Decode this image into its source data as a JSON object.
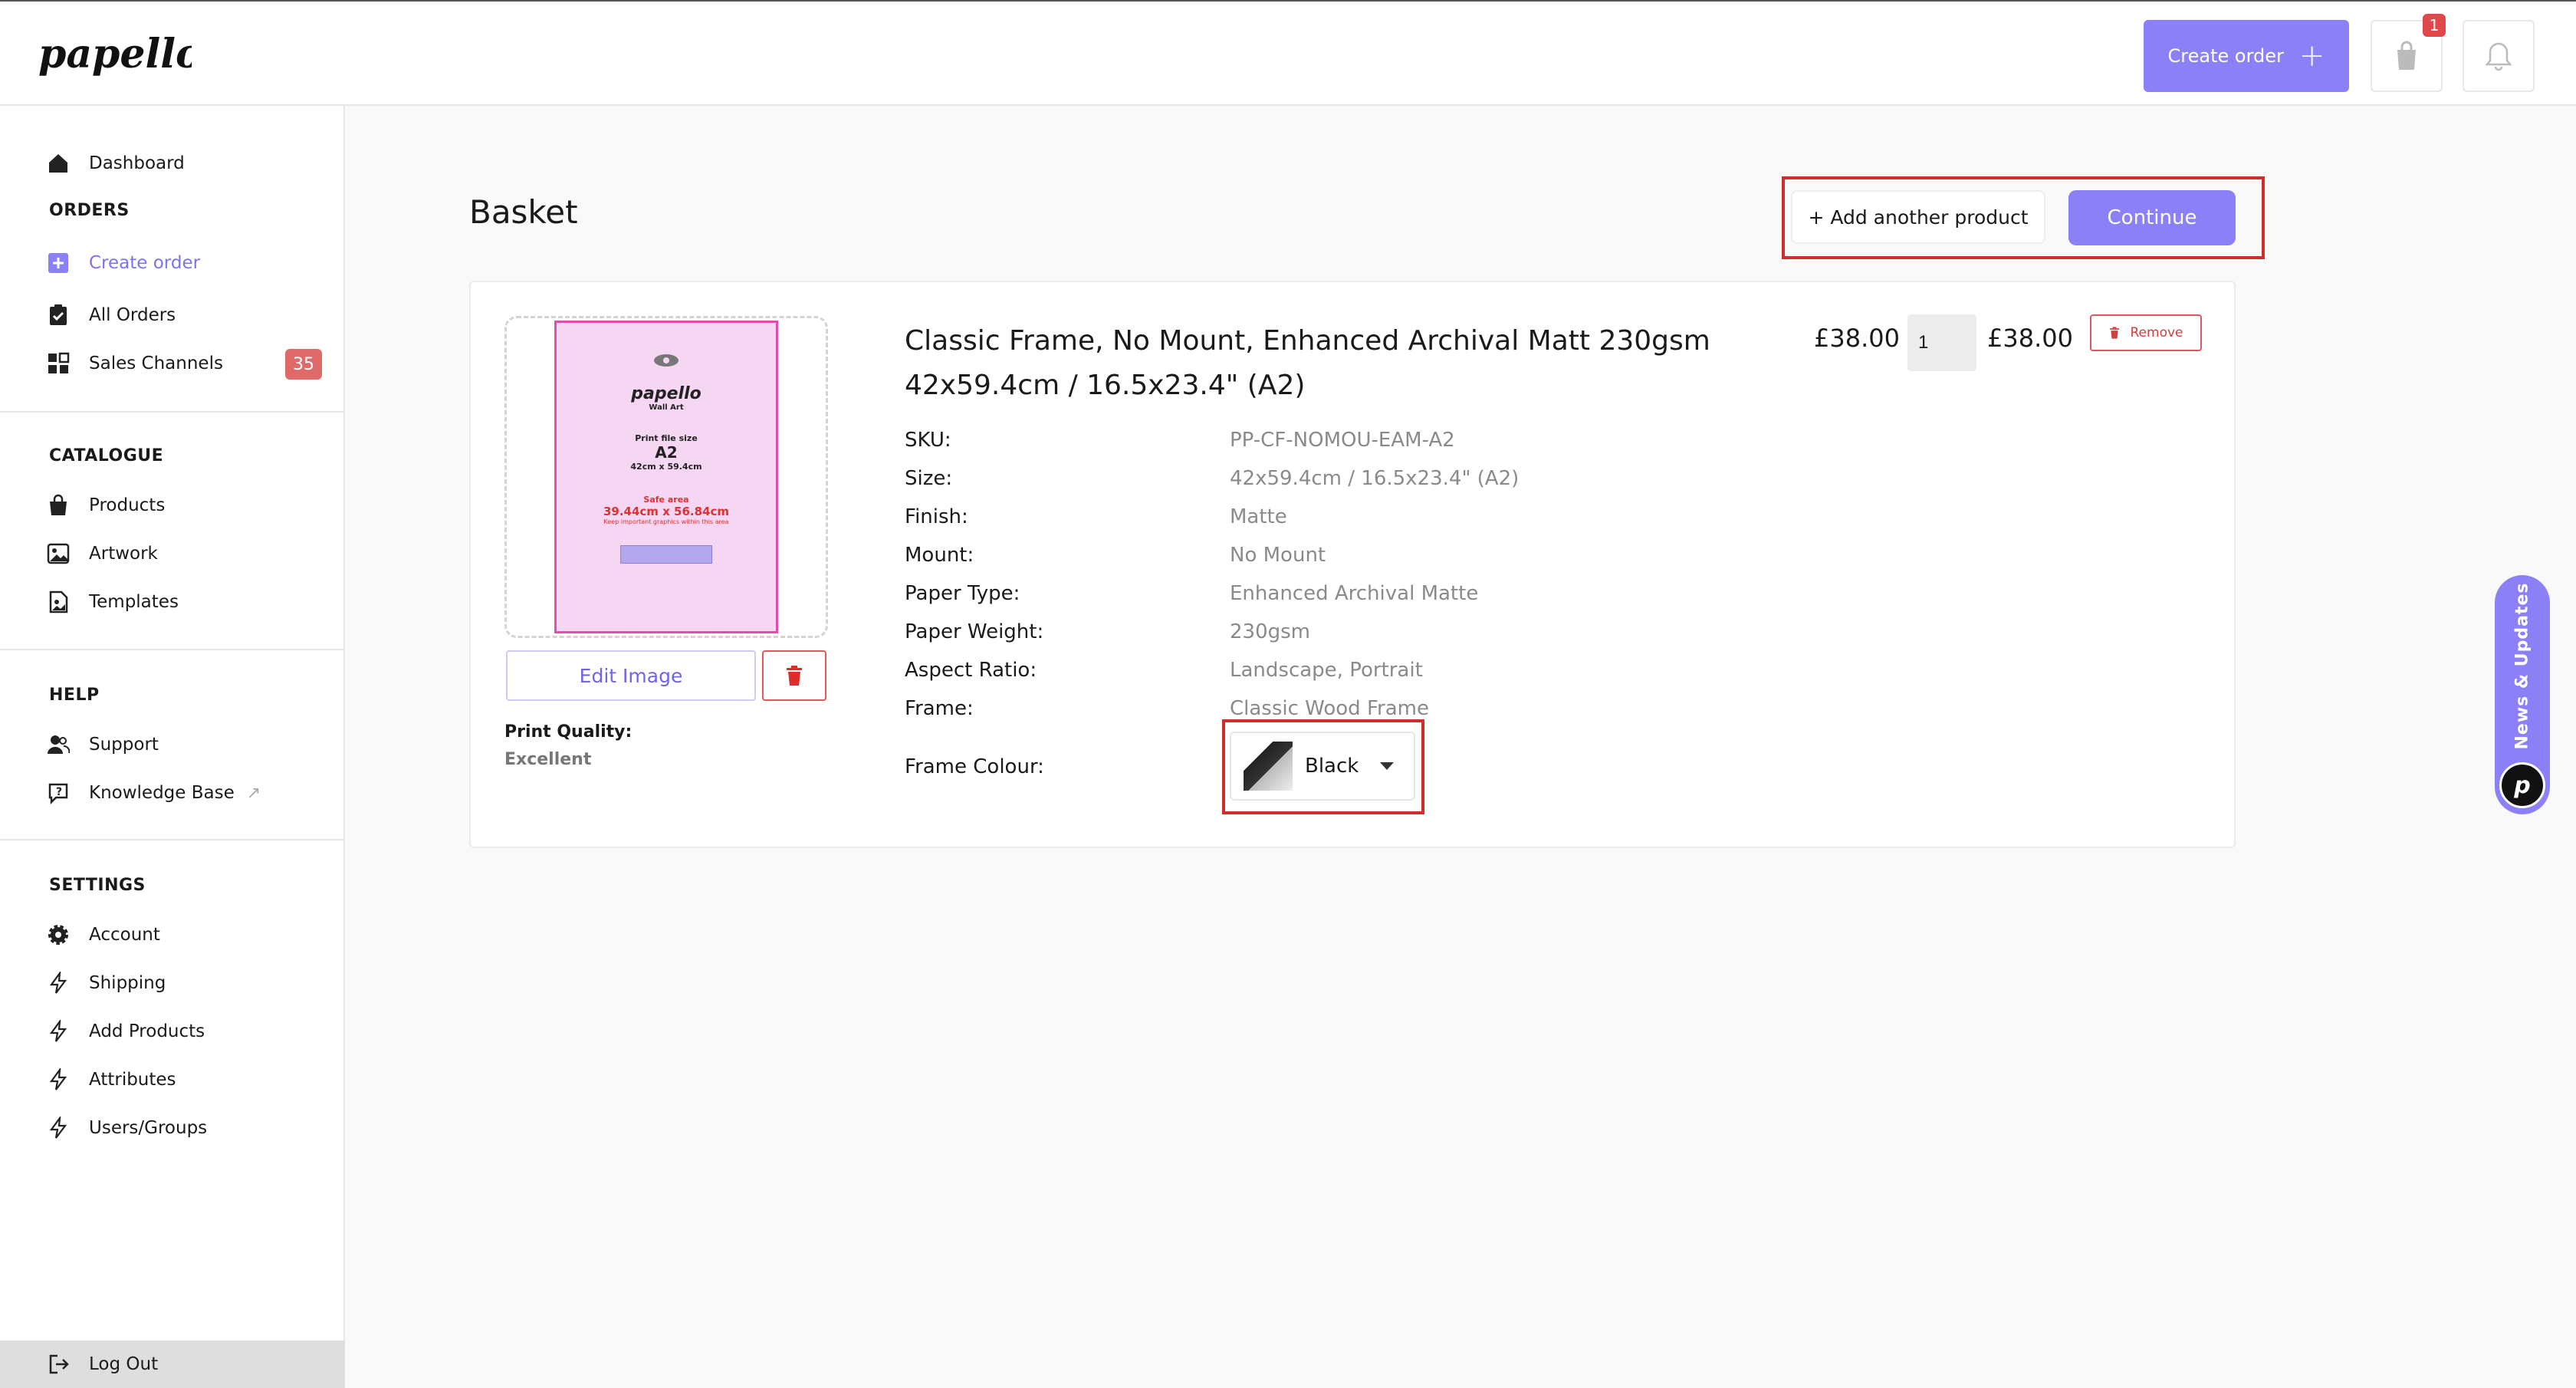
{
  "brand": {
    "logo_text": "papello"
  },
  "header": {
    "create_order_label": "Create order",
    "basket_count": "1"
  },
  "sidebar": {
    "items": [
      {
        "label": "Dashboard"
      },
      {
        "label": "Create order"
      },
      {
        "label": "All Orders"
      },
      {
        "label": "Sales Channels",
        "badge": "35"
      },
      {
        "label": "Products"
      },
      {
        "label": "Artwork"
      },
      {
        "label": "Templates"
      },
      {
        "label": "Support"
      },
      {
        "label": "Knowledge Base"
      },
      {
        "label": "Account"
      },
      {
        "label": "Shipping"
      },
      {
        "label": "Add Products"
      },
      {
        "label": "Attributes"
      },
      {
        "label": "Users/Groups"
      },
      {
        "label": "Log Out"
      }
    ],
    "sections": {
      "orders": "ORDERS",
      "catalogue": "CATALOGUE",
      "help": "HELP",
      "settings": "SETTINGS"
    }
  },
  "page": {
    "title": "Basket",
    "add_product_label": "+ Add another product",
    "continue_label": "Continue"
  },
  "product": {
    "title": "Classic Frame, No Mount, Enhanced Archival Matt 230gsm 42x59.4cm / 16.5x23.4\" (A2)",
    "unit_price": "£38.00",
    "quantity": "1",
    "total_price": "£38.00",
    "remove_label": "Remove",
    "edit_image_label": "Edit Image",
    "print_quality_label": "Print Quality:",
    "print_quality_value": "Excellent",
    "specs": [
      {
        "key": "SKU:",
        "value": "PP-CF-NOMOU-EAM-A2"
      },
      {
        "key": "Size:",
        "value": "42x59.4cm / 16.5x23.4\" (A2)"
      },
      {
        "key": "Finish:",
        "value": "Matte"
      },
      {
        "key": "Mount:",
        "value": "No Mount"
      },
      {
        "key": "Paper Type:",
        "value": "Enhanced Archival Matte"
      },
      {
        "key": "Paper Weight:",
        "value": "230gsm"
      },
      {
        "key": "Aspect Ratio:",
        "value": "Landscape, Portrait"
      },
      {
        "key": "Frame:",
        "value": "Classic Wood Frame"
      }
    ],
    "frame_colour_label": "Frame Colour:",
    "frame_colour_value": "Black",
    "preview": {
      "logo": "papello",
      "sub": "Wall Art",
      "print_file_size": "Print file size",
      "size_name": "A2",
      "size_dims": "42cm x 59.4cm",
      "safe_area": "Safe area",
      "safe_dims": "39.44cm x 56.84cm",
      "safe_note": "Keep important graphics within this area"
    }
  },
  "news_tab": {
    "label": "News & Updates"
  },
  "colors": {
    "accent": "#8b80f5",
    "danger": "#d12c2c"
  }
}
